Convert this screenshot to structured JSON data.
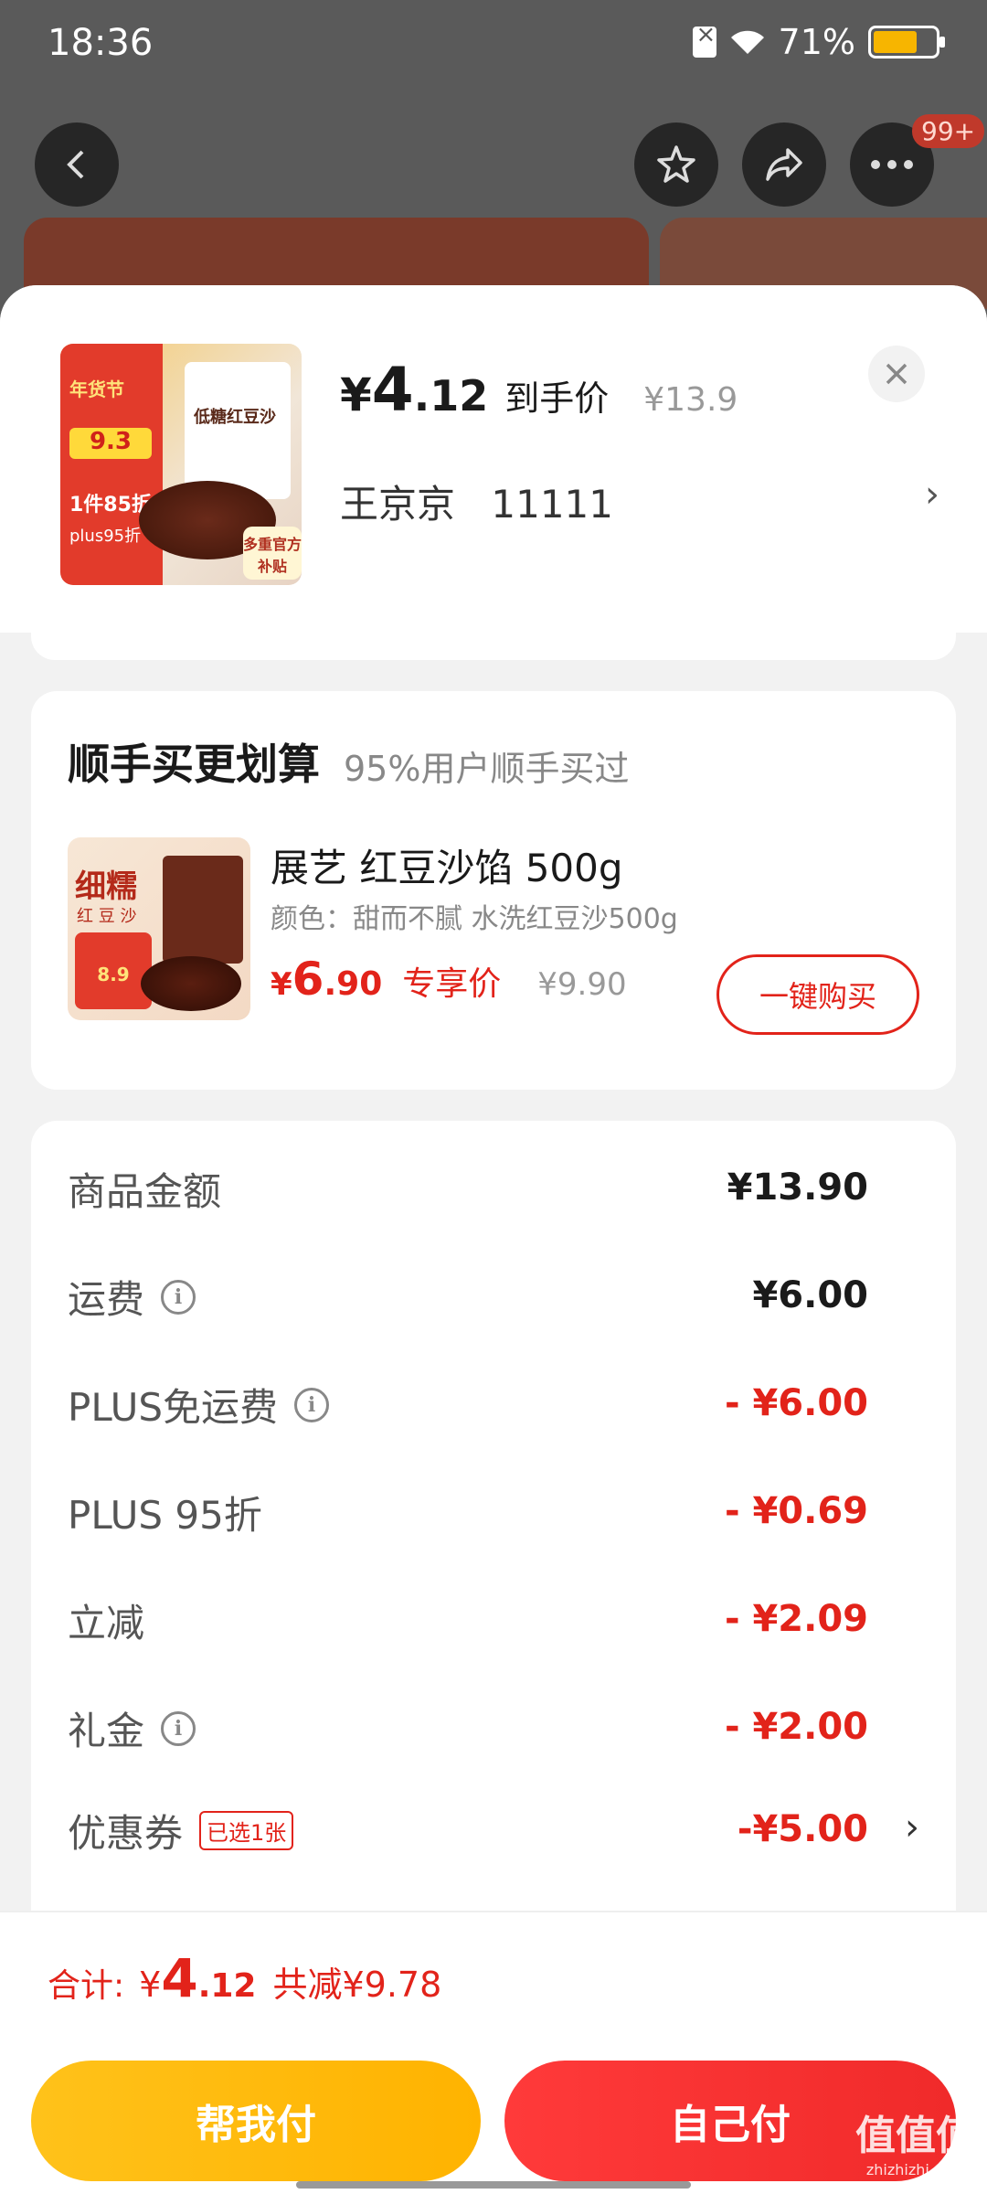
{
  "status": {
    "time": "18:36",
    "battery": "71%",
    "battery_level": 0.71
  },
  "nav": {
    "badge": "99+"
  },
  "product": {
    "price_yen": "¥",
    "price_int": "4",
    "price_dec": ".12",
    "price_label": "到手价",
    "orig_price": "¥13.9",
    "address_name": "王京京",
    "address_code": "11111",
    "image_texts": {
      "festival": "年货节",
      "badge": "9.3",
      "deal": "1件85折",
      "plus": "plus95折",
      "bag": "低糖红豆沙",
      "subsidy": "多重官方补贴"
    }
  },
  "combo": {
    "title": "顺手买更划算",
    "subtitle": "95%用户顺手买过",
    "name": "展艺 红豆沙馅 500g",
    "spec": "颜色：甜而不腻 水洗红豆沙500g",
    "price_yen": "¥",
    "price_int": "6",
    "price_dec": ".90",
    "price_label": "专享价",
    "orig_price": "¥9.90",
    "buy_label": "一键购买",
    "image_texts": {
      "title": "细糯",
      "sub": "红 豆 沙",
      "badge": "8.9"
    }
  },
  "summary": {
    "rows": [
      {
        "label": "商品金额",
        "value": "¥13.90",
        "info": false
      },
      {
        "label": "运费",
        "value": "¥6.00",
        "info": true
      },
      {
        "label": "PLUS免运费",
        "value": "- ¥6.00",
        "info": true
      },
      {
        "label": "PLUS 95折",
        "value": "- ¥0.69",
        "info": false
      },
      {
        "label": "立减",
        "value": "- ¥2.09",
        "info": false
      },
      {
        "label": "礼金",
        "value": "- ¥2.00",
        "info": true
      }
    ],
    "coupon": {
      "label": "优惠券",
      "tag": "已选1张",
      "value": "-¥5.00"
    }
  },
  "total": {
    "label": "合计:",
    "yen": "¥",
    "int": "4",
    "dec": ".12",
    "save": "共减¥9.78"
  },
  "actions": {
    "help_pay": "帮我付",
    "self_pay": "自己付"
  },
  "watermark": {
    "main": "值值值",
    "sub": "zhizhizhi.com"
  }
}
